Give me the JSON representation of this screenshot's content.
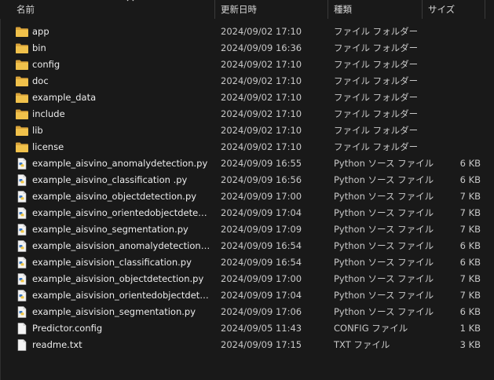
{
  "columns": {
    "name": "名前",
    "date": "更新日時",
    "type": "種類",
    "size": "サイズ"
  },
  "colors": {
    "folder": "#e8b84a",
    "background": "#191919",
    "python_icon": "#4a90d9"
  },
  "rows": [
    {
      "icon": "folder-icon",
      "name": "app",
      "date": "2024/09/02 17:10",
      "type": "ファイル フォルダー",
      "size": ""
    },
    {
      "icon": "folder-icon",
      "name": "bin",
      "date": "2024/09/09 16:36",
      "type": "ファイル フォルダー",
      "size": ""
    },
    {
      "icon": "folder-icon",
      "name": "config",
      "date": "2024/09/02 17:10",
      "type": "ファイル フォルダー",
      "size": ""
    },
    {
      "icon": "folder-icon",
      "name": "doc",
      "date": "2024/09/02 17:10",
      "type": "ファイル フォルダー",
      "size": ""
    },
    {
      "icon": "folder-icon",
      "name": "example_data",
      "date": "2024/09/02 17:10",
      "type": "ファイル フォルダー",
      "size": ""
    },
    {
      "icon": "folder-icon",
      "name": "include",
      "date": "2024/09/02 17:10",
      "type": "ファイル フォルダー",
      "size": ""
    },
    {
      "icon": "folder-icon",
      "name": "lib",
      "date": "2024/09/02 17:10",
      "type": "ファイル フォルダー",
      "size": ""
    },
    {
      "icon": "folder-icon",
      "name": "license",
      "date": "2024/09/02 17:10",
      "type": "ファイル フォルダー",
      "size": ""
    },
    {
      "icon": "python-file-icon",
      "name": "example_aisvino_anomalydetection.py",
      "date": "2024/09/09 16:55",
      "type": "Python ソース ファイル",
      "size": "6 KB"
    },
    {
      "icon": "python-file-icon",
      "name": "example_aisvino_classification .py",
      "date": "2024/09/09 16:56",
      "type": "Python ソース ファイル",
      "size": "6 KB"
    },
    {
      "icon": "python-file-icon",
      "name": "example_aisvino_objectdetection.py",
      "date": "2024/09/09 17:00",
      "type": "Python ソース ファイル",
      "size": "7 KB"
    },
    {
      "icon": "python-file-icon",
      "name": "example_aisvino_orientedobjectdetectio...",
      "date": "2024/09/09 17:04",
      "type": "Python ソース ファイル",
      "size": "7 KB"
    },
    {
      "icon": "python-file-icon",
      "name": "example_aisvino_segmentation.py",
      "date": "2024/09/09 17:09",
      "type": "Python ソース ファイル",
      "size": "7 KB"
    },
    {
      "icon": "python-file-icon",
      "name": "example_aisvision_anomalydetection.py",
      "date": "2024/09/09 16:54",
      "type": "Python ソース ファイル",
      "size": "6 KB"
    },
    {
      "icon": "python-file-icon",
      "name": "example_aisvision_classification.py",
      "date": "2024/09/09 16:54",
      "type": "Python ソース ファイル",
      "size": "6 KB"
    },
    {
      "icon": "python-file-icon",
      "name": "example_aisvision_objectdetection.py",
      "date": "2024/09/09 17:00",
      "type": "Python ソース ファイル",
      "size": "7 KB"
    },
    {
      "icon": "python-file-icon",
      "name": "example_aisvision_orientedobjectdetecti...",
      "date": "2024/09/09 17:04",
      "type": "Python ソース ファイル",
      "size": "7 KB"
    },
    {
      "icon": "python-file-icon",
      "name": "example_aisvision_segmentation.py",
      "date": "2024/09/09 17:06",
      "type": "Python ソース ファイル",
      "size": "6 KB"
    },
    {
      "icon": "file-icon",
      "name": "Predictor.config",
      "date": "2024/09/05 11:43",
      "type": "CONFIG ファイル",
      "size": "1 KB"
    },
    {
      "icon": "file-icon",
      "name": "readme.txt",
      "date": "2024/09/09 17:15",
      "type": "TXT ファイル",
      "size": "3 KB"
    }
  ]
}
